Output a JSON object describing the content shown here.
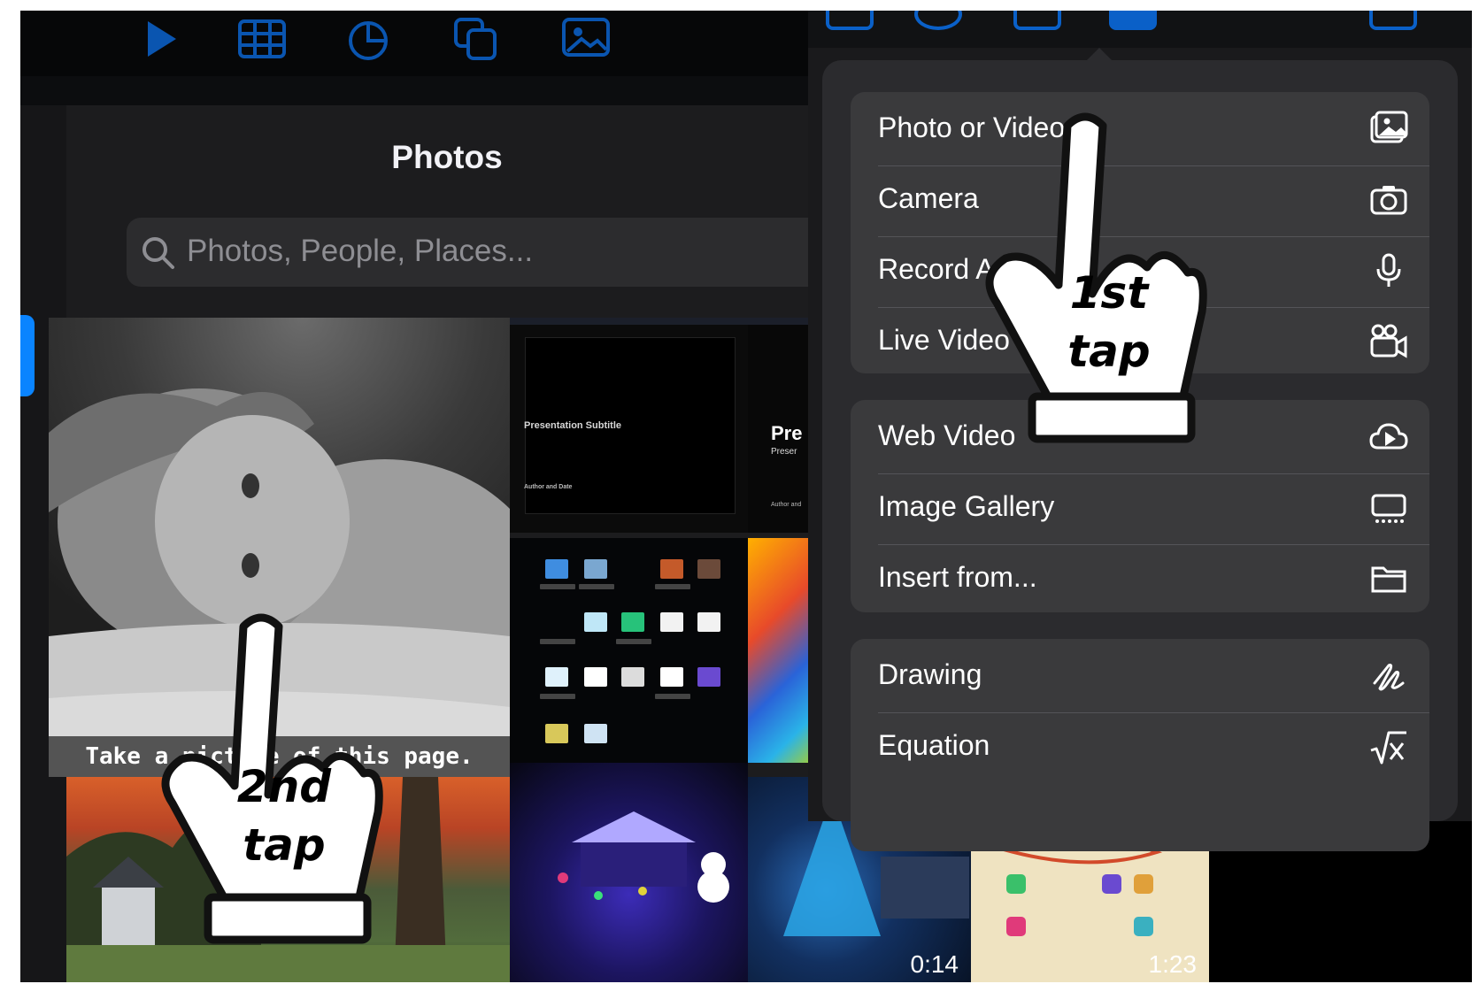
{
  "photos": {
    "title": "Photos",
    "search_placeholder": "Photos, People, Places...",
    "caption": "Take a picture of this page.",
    "slide_subtitle": "Presentation Subtitle",
    "slide_author": "Author and Date",
    "slide2_title": "Pre",
    "slide2_sub": "Preser",
    "slide2_author": "Author and",
    "video_durations": [
      "0:14",
      "1:23"
    ]
  },
  "insert_menu": {
    "groups": [
      {
        "items": [
          {
            "label": "Photo or Video",
            "icon": "photo-library-icon"
          },
          {
            "label": "Camera",
            "icon": "camera-icon"
          },
          {
            "label": "Record Audio",
            "icon": "microphone-icon"
          },
          {
            "label": "Live Video",
            "icon": "video-camera-icon"
          }
        ]
      },
      {
        "items": [
          {
            "label": "Web Video",
            "icon": "cloud-play-icon"
          },
          {
            "label": "Image Gallery",
            "icon": "gallery-icon"
          },
          {
            "label": "Insert from...",
            "icon": "folder-icon"
          }
        ]
      },
      {
        "items": [
          {
            "label": "Drawing",
            "icon": "scribble-icon"
          },
          {
            "label": "Equation",
            "icon": "square-root-icon"
          }
        ]
      }
    ]
  },
  "annotations": {
    "first_tap": [
      "1st",
      "tap"
    ],
    "second_tap": [
      "2nd",
      "tap"
    ]
  },
  "colors": {
    "accent": "#0a84ff",
    "menu_bg": "#2b2b2e",
    "menu_group_bg": "#3a3a3c"
  }
}
